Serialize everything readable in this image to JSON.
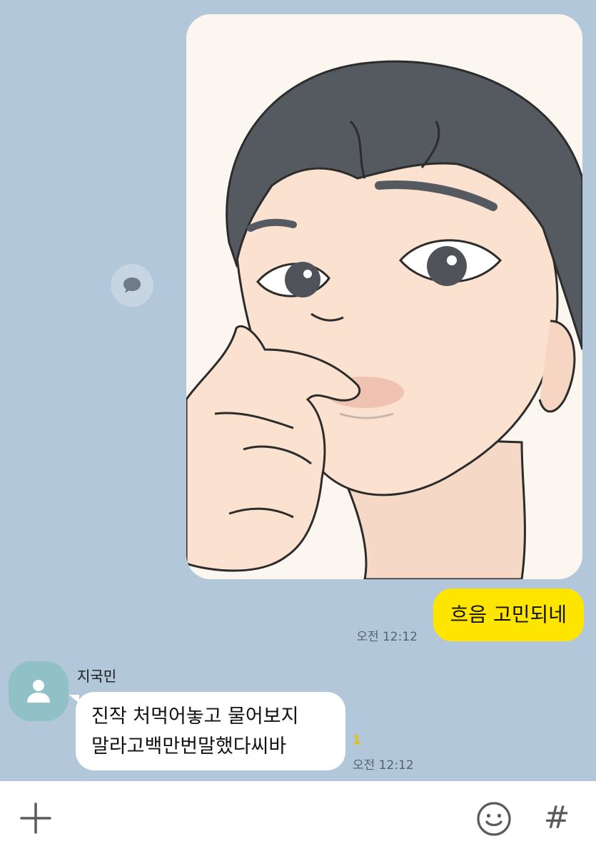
{
  "chat": {
    "outgoing": {
      "text": "흐음 고민되네",
      "time": "오전 12:12"
    },
    "incoming": {
      "sender": "지국민",
      "lines": [
        "진작 처먹어놓고 물어보지",
        "말라고백만번말했다씨바"
      ],
      "unread": "1",
      "time": "오전 12:12"
    }
  },
  "icons": {
    "share": "speech-bubble-icon",
    "avatar": "default-person-icon",
    "plus": "plus-icon",
    "emoji": "smiley-icon",
    "hash": "hash-icon"
  },
  "input_bar": {
    "hash_label": "#"
  },
  "colors": {
    "chat_background": "#b2c7da",
    "outgoing_bubble": "#fee500",
    "incoming_bubble": "#ffffff",
    "unread_count": "#e2c400",
    "avatar_background": "#8fc1c6"
  }
}
